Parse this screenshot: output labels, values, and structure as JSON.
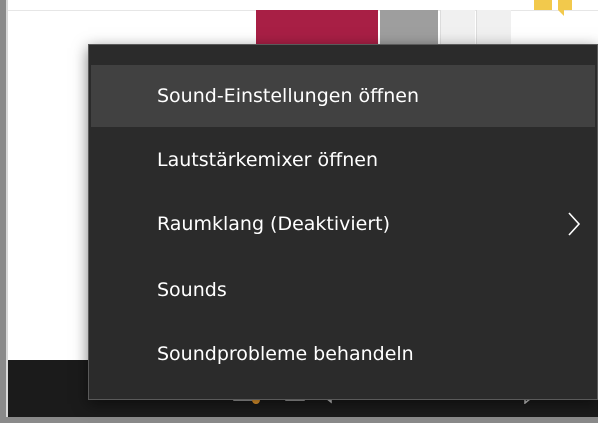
{
  "menu": {
    "items": [
      {
        "label": "Sound-Einstellungen öffnen",
        "highlighted": true
      },
      {
        "label": "Lautstärkemixer öffnen",
        "highlighted": false
      },
      {
        "label": "Raumklang (Deaktiviert)",
        "highlighted": false,
        "submenu_icon": "chevron-right-icon"
      },
      {
        "label": "Sounds",
        "highlighted": false
      },
      {
        "label": "Soundprobleme behandeln",
        "highlighted": false
      }
    ]
  },
  "colors": {
    "menu_background": "#2b2b2b",
    "menu_highlight": "#414141",
    "menu_text": "#ffffff",
    "accent_crimson": "#a81f45",
    "taskbar": "#1b1b1b"
  },
  "icons": {
    "tray_chat": "chat-icon",
    "tray_speaker": "speaker-icon",
    "tray_network": "network-icon",
    "tray_notifications": "notifications-icon",
    "corner_decoration": "sticky-note-icon"
  }
}
